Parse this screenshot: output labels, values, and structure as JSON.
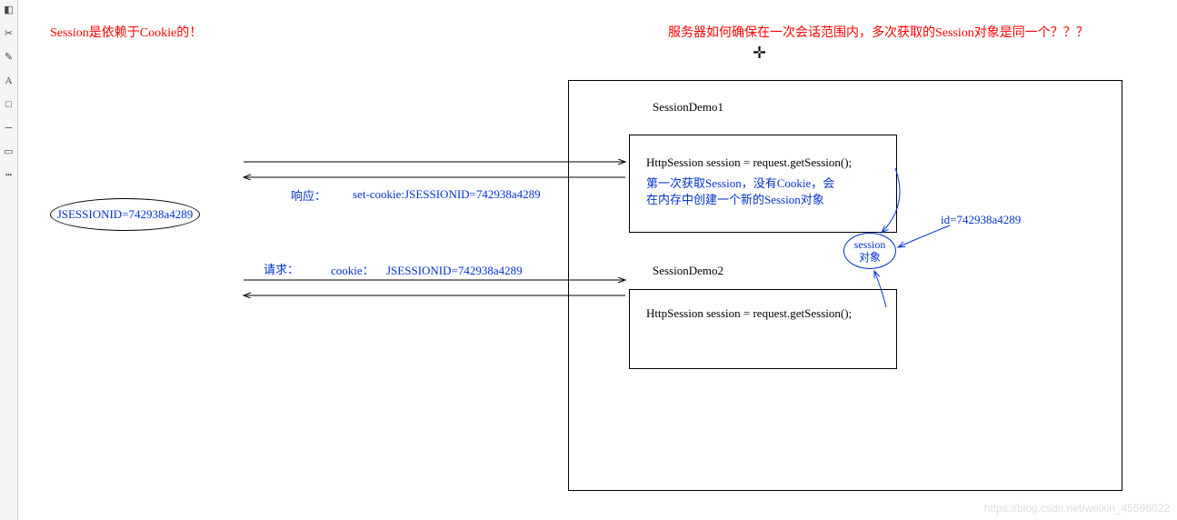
{
  "notes": {
    "top_left": "Session是依赖于Cookie的！",
    "top_right": "服务器如何确保在一次会话范围内，多次获取的Session对象是同一个？？？"
  },
  "client": {
    "label": "JSESSIONID=742938a4289"
  },
  "server": {
    "demo1_title": "SessionDemo1",
    "demo1_code": "HttpSession session = request.getSession();",
    "demo1_note_line1": "第一次获取Session，没有Cookie，会",
    "demo1_note_line2": "在内存中创建一个新的Session对象",
    "demo2_title": "SessionDemo2",
    "demo2_code": "HttpSession session = request.getSession();",
    "session_obj_line1": "session",
    "session_obj_line2": "对象",
    "id_label": "id=742938a4289"
  },
  "arrows": {
    "response_label": "响应：",
    "response_header": "set-cookie:JSESSIONID=742938a4289",
    "request_label": "请求：",
    "request_cookie_label": "cookie：",
    "request_cookie_value": "JSESSIONID=742938a4289"
  },
  "toolbar_icons": [
    "eraser",
    "crop",
    "pencil",
    "text",
    "select",
    "line",
    "rect",
    "dotted",
    "arrow"
  ],
  "watermark": "https://blog.csdn.net/weixin_45596022"
}
